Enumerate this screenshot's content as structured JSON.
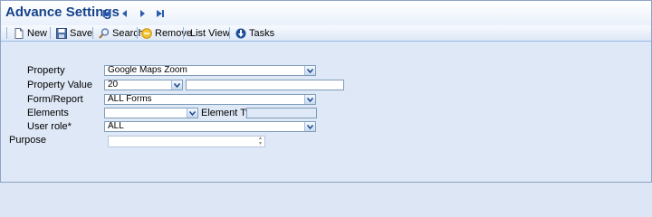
{
  "window": {
    "title": "Advance Settings"
  },
  "nav": [
    {
      "name": "first-record-button",
      "icon": "first-record-icon"
    },
    {
      "name": "previous-record-button",
      "icon": "previous-record-icon"
    },
    {
      "name": "next-record-button",
      "icon": "next-record-icon"
    },
    {
      "name": "last-record-button",
      "icon": "last-record-icon"
    }
  ],
  "toolbar": {
    "new_label": "New",
    "save_label": "Save",
    "search_label": "Search",
    "remove_label": "Remove",
    "list_view_label": "List View",
    "tasks_label": "Tasks"
  },
  "form": {
    "property_label": "Property",
    "property_value": "Google Maps Zoom",
    "property_value_label": "Property Value",
    "property_value_select": "20",
    "property_value_text": "",
    "form_report_label": "Form/Report",
    "form_report_value": "ALL Forms",
    "elements_label": "Elements",
    "elements_value": "",
    "element_type_label": "Element Type",
    "element_type_value": "",
    "user_role_label": "User role*",
    "user_role_value": "ALL",
    "purpose_label": "Purpose",
    "purpose_value": ""
  },
  "colors": {
    "title": "#15428b",
    "nav_icon": "#2a5db0",
    "background": "#dfe8f6"
  }
}
